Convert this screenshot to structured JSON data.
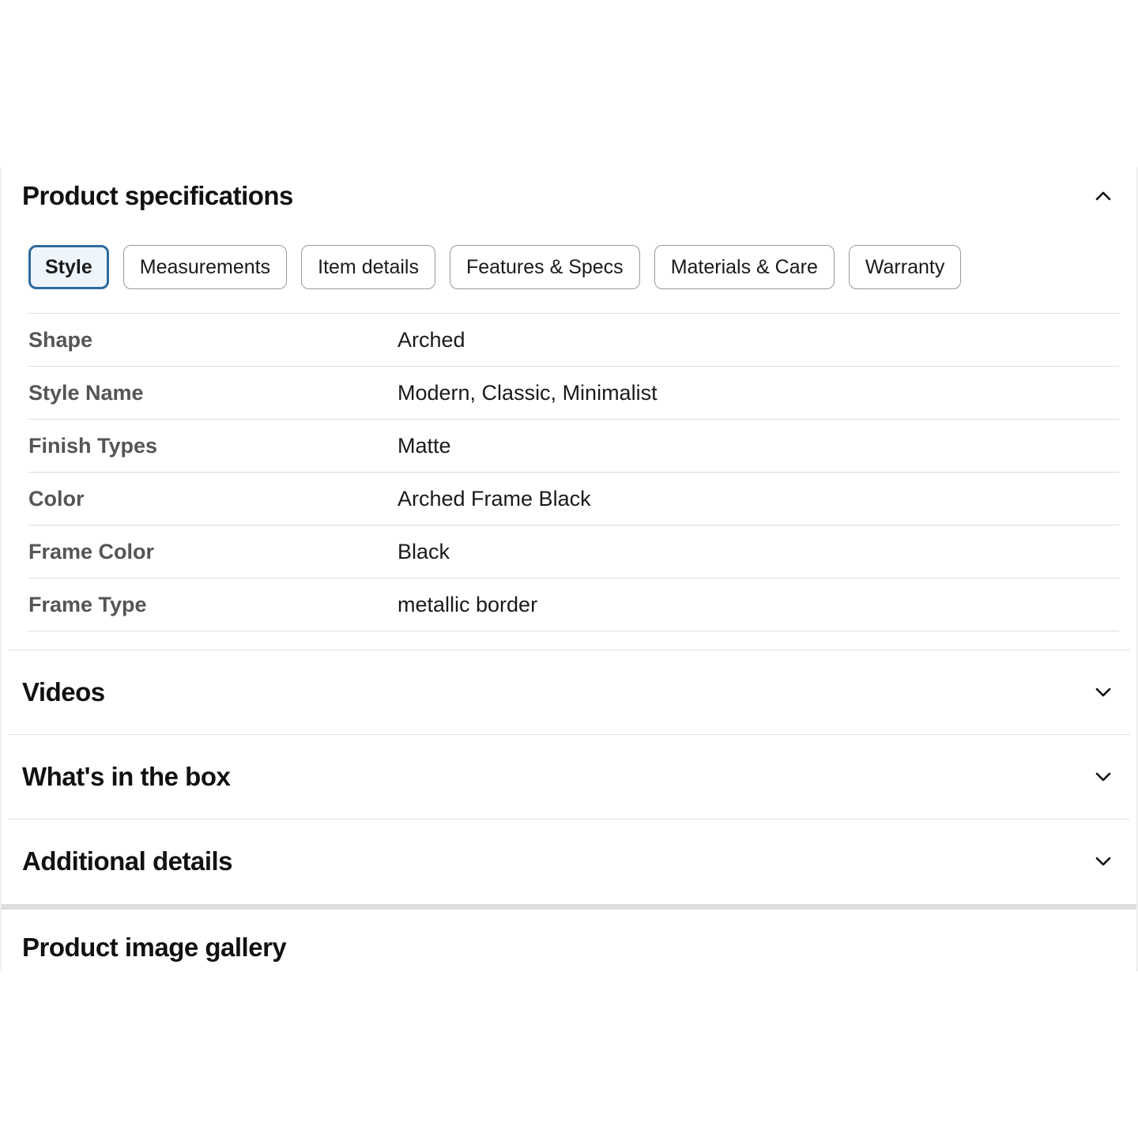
{
  "spec": {
    "title": "Product specifications",
    "tabs": [
      {
        "label": "Style",
        "active": true
      },
      {
        "label": "Measurements",
        "active": false
      },
      {
        "label": "Item details",
        "active": false
      },
      {
        "label": "Features & Specs",
        "active": false
      },
      {
        "label": "Materials & Care",
        "active": false
      },
      {
        "label": "Warranty",
        "active": false
      }
    ],
    "rows": [
      {
        "key": "Shape",
        "value": "Arched"
      },
      {
        "key": "Style Name",
        "value": "Modern, Classic, Minimalist"
      },
      {
        "key": "Finish Types",
        "value": "Matte"
      },
      {
        "key": "Color",
        "value": "Arched Frame Black"
      },
      {
        "key": "Frame Color",
        "value": "Black"
      },
      {
        "key": "Frame Type",
        "value": "metallic border"
      }
    ]
  },
  "sections": {
    "videos": "Videos",
    "in_box": "What's in the box",
    "additional": "Additional details",
    "gallery": "Product image gallery"
  },
  "icons": {
    "expanded": "chevron-up-icon",
    "collapsed": "chevron-down-icon"
  },
  "colors": {
    "active_tab_border": "#2e6a9c",
    "active_tab_bg": "#eef5fb",
    "key_text": "#555555"
  }
}
